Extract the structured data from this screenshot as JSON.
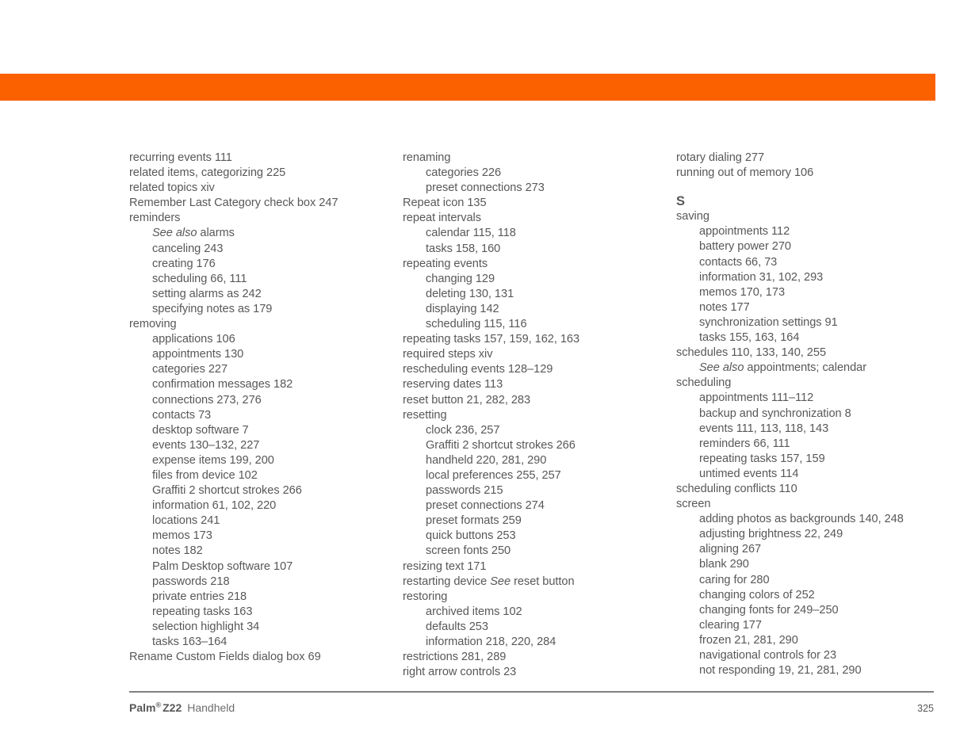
{
  "header": {
    "bar_color": "#fc6100"
  },
  "index": {
    "columns": [
      {
        "name": "index-column-1",
        "entries": [
          {
            "level": 0,
            "text": "recurring events 111"
          },
          {
            "level": 0,
            "text": "related items, categorizing 225"
          },
          {
            "level": 0,
            "text": "related topics xiv"
          },
          {
            "level": 0,
            "text": "Remember Last Category check box 247"
          },
          {
            "level": 0,
            "text": "reminders"
          },
          {
            "level": 1,
            "italic_prefix": "See also",
            "text": " alarms"
          },
          {
            "level": 1,
            "text": "canceling 243"
          },
          {
            "level": 1,
            "text": "creating 176"
          },
          {
            "level": 1,
            "text": "scheduling 66, 111"
          },
          {
            "level": 1,
            "text": "setting alarms as 242"
          },
          {
            "level": 1,
            "text": "specifying notes as 179"
          },
          {
            "level": 0,
            "text": "removing"
          },
          {
            "level": 1,
            "text": "applications 106"
          },
          {
            "level": 1,
            "text": "appointments 130"
          },
          {
            "level": 1,
            "text": "categories 227"
          },
          {
            "level": 1,
            "text": "confirmation messages 182"
          },
          {
            "level": 1,
            "text": "connections 273, 276"
          },
          {
            "level": 1,
            "text": "contacts 73"
          },
          {
            "level": 1,
            "text": "desktop software 7"
          },
          {
            "level": 1,
            "text": "events 130–132, 227"
          },
          {
            "level": 1,
            "text": "expense items 199, 200"
          },
          {
            "level": 1,
            "text": "files from device 102"
          },
          {
            "level": 1,
            "text": "Graffiti 2 shortcut strokes 266"
          },
          {
            "level": 1,
            "text": "information 61, 102, 220"
          },
          {
            "level": 1,
            "text": "locations 241"
          },
          {
            "level": 1,
            "text": "memos 173"
          },
          {
            "level": 1,
            "text": "notes 182"
          },
          {
            "level": 1,
            "text": "Palm Desktop software 107"
          },
          {
            "level": 1,
            "text": "passwords 218"
          },
          {
            "level": 1,
            "text": "private entries 218"
          },
          {
            "level": 1,
            "text": "repeating tasks 163"
          },
          {
            "level": 1,
            "text": "selection highlight 34"
          },
          {
            "level": 1,
            "text": "tasks 163–164"
          },
          {
            "level": 0,
            "text": "Rename Custom Fields dialog box 69"
          }
        ]
      },
      {
        "name": "index-column-2",
        "entries": [
          {
            "level": 0,
            "text": "renaming"
          },
          {
            "level": 1,
            "text": "categories 226"
          },
          {
            "level": 1,
            "text": "preset connections 273"
          },
          {
            "level": 0,
            "text": "Repeat icon 135"
          },
          {
            "level": 0,
            "text": "repeat intervals"
          },
          {
            "level": 1,
            "text": "calendar 115, 118"
          },
          {
            "level": 1,
            "text": "tasks 158, 160"
          },
          {
            "level": 0,
            "text": "repeating events"
          },
          {
            "level": 1,
            "text": "changing 129"
          },
          {
            "level": 1,
            "text": "deleting 130, 131"
          },
          {
            "level": 1,
            "text": "displaying 142"
          },
          {
            "level": 1,
            "text": "scheduling 115, 116"
          },
          {
            "level": 0,
            "text": "repeating tasks 157, 159, 162, 163"
          },
          {
            "level": 0,
            "text": "required steps xiv"
          },
          {
            "level": 0,
            "text": "rescheduling events 128–129"
          },
          {
            "level": 0,
            "text": "reserving dates 113"
          },
          {
            "level": 0,
            "text": "reset button 21, 282, 283"
          },
          {
            "level": 0,
            "text": "resetting"
          },
          {
            "level": 1,
            "text": "clock 236, 257"
          },
          {
            "level": 1,
            "text": "Graffiti 2 shortcut strokes 266"
          },
          {
            "level": 1,
            "text": "handheld 220, 281, 290"
          },
          {
            "level": 1,
            "text": "local preferences 255, 257"
          },
          {
            "level": 1,
            "text": "passwords 215"
          },
          {
            "level": 1,
            "text": "preset connections 274"
          },
          {
            "level": 1,
            "text": "preset formats 259"
          },
          {
            "level": 1,
            "text": "quick buttons 253"
          },
          {
            "level": 1,
            "text": "screen fonts 250"
          },
          {
            "level": 0,
            "text": "resizing text 171"
          },
          {
            "level": 0,
            "text": "restarting device ",
            "italic_suffix": "See",
            "text_after": " reset button"
          },
          {
            "level": 0,
            "text": "restoring"
          },
          {
            "level": 1,
            "text": "archived items 102"
          },
          {
            "level": 1,
            "text": "defaults 253"
          },
          {
            "level": 1,
            "text": "information 218, 220, 284"
          },
          {
            "level": 0,
            "text": "restrictions 281, 289"
          },
          {
            "level": 0,
            "text": "right arrow controls 23"
          }
        ]
      },
      {
        "name": "index-column-3",
        "entries": [
          {
            "level": 0,
            "text": "rotary dialing 277"
          },
          {
            "level": 0,
            "text": "running out of memory 106"
          },
          {
            "level": 0,
            "text": "S",
            "is_letter": true
          },
          {
            "level": 0,
            "text": "saving"
          },
          {
            "level": 1,
            "text": "appointments 112"
          },
          {
            "level": 1,
            "text": "battery power 270"
          },
          {
            "level": 1,
            "text": "contacts 66, 73"
          },
          {
            "level": 1,
            "text": "information 31, 102, 293"
          },
          {
            "level": 1,
            "text": "memos 170, 173"
          },
          {
            "level": 1,
            "text": "notes 177"
          },
          {
            "level": 1,
            "text": "synchronization settings 91"
          },
          {
            "level": 1,
            "text": "tasks 155, 163, 164"
          },
          {
            "level": 0,
            "text": "schedules 110, 133, 140, 255"
          },
          {
            "level": 1,
            "italic_prefix": "See also",
            "text": " appointments; calendar"
          },
          {
            "level": 0,
            "text": "scheduling"
          },
          {
            "level": 1,
            "text": "appointments 111–112"
          },
          {
            "level": 1,
            "text": "backup and synchronization 8"
          },
          {
            "level": 1,
            "text": "events 111, 113, 118, 143"
          },
          {
            "level": 1,
            "text": "reminders 66, 111"
          },
          {
            "level": 1,
            "text": "repeating tasks 157, 159"
          },
          {
            "level": 1,
            "text": "untimed events 114"
          },
          {
            "level": 0,
            "text": "scheduling conflicts 110"
          },
          {
            "level": 0,
            "text": "screen"
          },
          {
            "level": 1,
            "text": "adding photos as backgrounds 140, 248"
          },
          {
            "level": 1,
            "text": "adjusting brightness 22, 249"
          },
          {
            "level": 1,
            "text": "aligning 267"
          },
          {
            "level": 1,
            "text": "blank 290"
          },
          {
            "level": 1,
            "text": "caring for 280"
          },
          {
            "level": 1,
            "text": "changing colors of 252"
          },
          {
            "level": 1,
            "text": "changing fonts for 249–250"
          },
          {
            "level": 1,
            "text": "clearing 177"
          },
          {
            "level": 1,
            "text": "frozen 21, 281, 290"
          },
          {
            "level": 1,
            "text": "navigational controls for 23"
          },
          {
            "level": 1,
            "text": "not responding 19, 21, 281, 290"
          }
        ]
      }
    ]
  },
  "footer": {
    "brand": "Palm",
    "registered_mark": "®",
    "model": "Z22",
    "product": "Handheld",
    "page_number": "325"
  }
}
